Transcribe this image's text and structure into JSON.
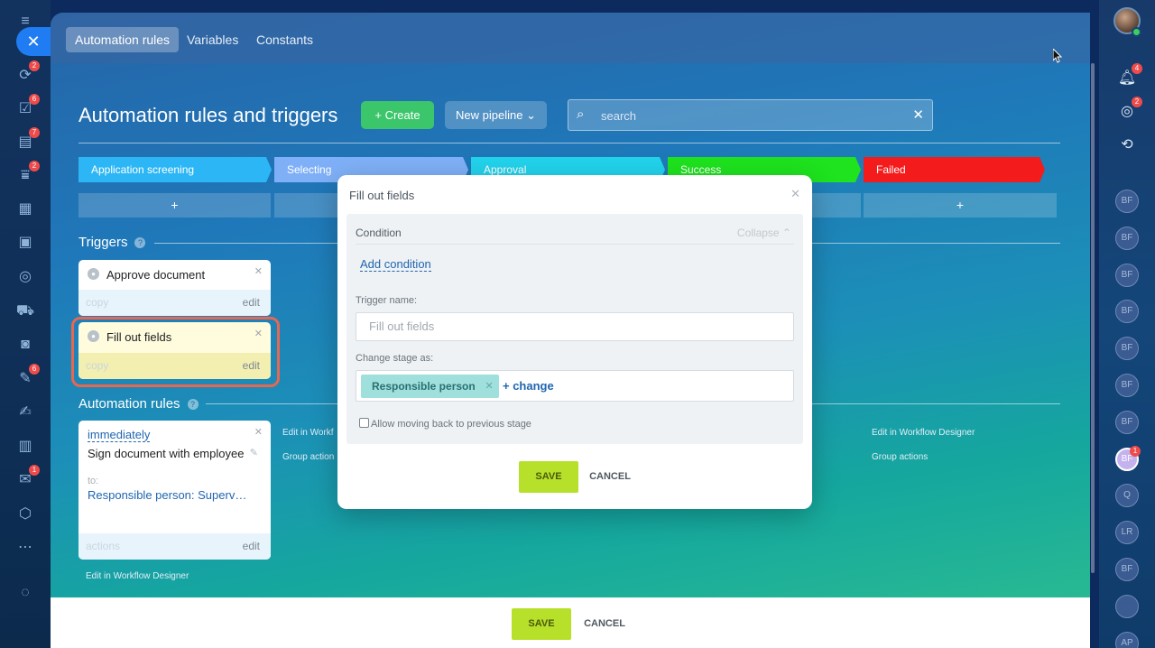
{
  "left_rail": {
    "close_label": "✕",
    "items": [
      {
        "icon": "menu-icon",
        "glyph": "≡"
      },
      {
        "icon": "flow-icon",
        "glyph": "⟳",
        "badge": "2"
      },
      {
        "icon": "tasks-icon",
        "glyph": "☑",
        "badge": "6"
      },
      {
        "icon": "crm-icon",
        "glyph": "▤",
        "badge": "7"
      },
      {
        "icon": "funnel-icon",
        "glyph": "⩸",
        "badge": "2"
      },
      {
        "icon": "calendar-icon",
        "glyph": "▦"
      },
      {
        "icon": "inbox-icon",
        "glyph": "▣"
      },
      {
        "icon": "target-icon",
        "glyph": "◎"
      },
      {
        "icon": "cart-icon",
        "glyph": "⛟"
      },
      {
        "icon": "camera-icon",
        "glyph": "◙"
      },
      {
        "icon": "sign-icon",
        "glyph": "✎",
        "badge": "6"
      },
      {
        "icon": "pen-icon",
        "glyph": "✍"
      },
      {
        "icon": "analytics-icon",
        "glyph": "▥"
      },
      {
        "icon": "mail-icon",
        "glyph": "✉",
        "badge": "1"
      },
      {
        "icon": "box-icon",
        "glyph": "⬡"
      },
      {
        "icon": "more-icon",
        "glyph": "⋯"
      },
      {
        "icon": "settings-icon",
        "glyph": "◌"
      }
    ]
  },
  "right_rail": {
    "notifications_badge": "4",
    "chat_badge": "2",
    "avatars": [
      "BF",
      "BF",
      "BF",
      "BF",
      "BF",
      "BF",
      "BF",
      "BF",
      "Q",
      "LR",
      "BF",
      "",
      "AP"
    ],
    "active_avatar_badge": "1"
  },
  "tabs": [
    {
      "label": "Automation rules",
      "active": true
    },
    {
      "label": "Variables",
      "active": false
    },
    {
      "label": "Constants",
      "active": false
    }
  ],
  "page_title": "Automation rules and triggers",
  "create_label": "+ Create",
  "pipeline_label": "New pipeline ⌄",
  "search": {
    "placeholder": "search"
  },
  "stages": [
    {
      "label": "Application screening",
      "color": "#2db6f5"
    },
    {
      "label": "Selecting",
      "color": "#7fb0f7"
    },
    {
      "label": "Approval",
      "color": "#22d3ec"
    },
    {
      "label": "Success",
      "color": "#1ee31e"
    },
    {
      "label": "Failed",
      "color": "#f31b1b"
    }
  ],
  "stage_add_label": "+",
  "triggers_title": "Triggers",
  "help_glyph": "?",
  "trigger_cards": [
    {
      "title": "Approve document",
      "copy": "copy",
      "edit": "edit",
      "close": "✕",
      "icon": "lock-icon"
    },
    {
      "title": "Fill out fields",
      "copy": "copy",
      "edit": "edit",
      "close": "✕",
      "icon": "lock-icon"
    }
  ],
  "automation_title": "Automation rules",
  "rule_card": {
    "timing": "immediately",
    "action": "Sign document with employee",
    "to_label": "to:",
    "to_value": "Responsible person: Superv…",
    "actions": "actions",
    "edit": "edit",
    "close": "✕"
  },
  "column_links": {
    "edit_workflow": "Edit in Workflow Designer",
    "group_actions": "Group actions",
    "edit_workflow_truncated": "Edit in Workf",
    "group_actions_truncated": "Group action"
  },
  "bottom_bar": {
    "save": "SAVE",
    "cancel": "CANCEL"
  },
  "dialog": {
    "title": "Fill out fields",
    "close": "✕",
    "condition_label": "Condition",
    "collapse_label": "Collapse ⌃",
    "add_condition": "Add condition",
    "trigger_name_label": "Trigger name:",
    "trigger_name_placeholder": "Fill out fields",
    "change_stage_label": "Change stage as:",
    "tag_label": "Responsible person",
    "tag_remove": "✕",
    "change_link": "+ change",
    "allow_back_label": "Allow moving back to previous stage",
    "save": "SAVE",
    "cancel": "CANCEL"
  }
}
